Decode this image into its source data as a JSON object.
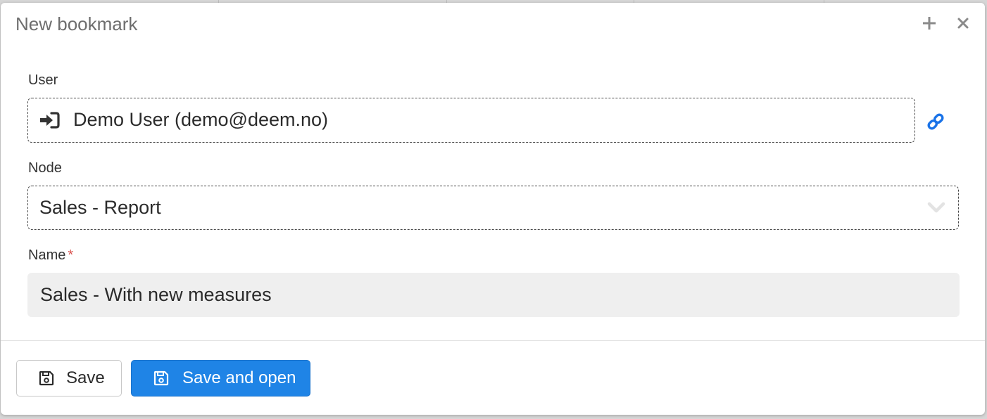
{
  "dialog": {
    "title": "New bookmark",
    "add_icon": "plus-icon",
    "close_icon": "close-icon"
  },
  "user": {
    "label": "User",
    "value": "Demo User (demo@deem.no)",
    "value_icon": "login-icon",
    "link_icon": "link-icon"
  },
  "node": {
    "label": "Node",
    "value": "Sales - Report",
    "dropdown_icon": "chevron-down-icon"
  },
  "name": {
    "label": "Name",
    "required_marker": "*",
    "value": "Sales - With new measures"
  },
  "footer": {
    "save_label": "Save",
    "save_open_label": "Save and open",
    "save_icon": "floppy-disk-icon"
  },
  "colors": {
    "primary": "#1f84e6",
    "link": "#1a73e8",
    "required": "#d9534f",
    "input_bg": "#efefef"
  }
}
